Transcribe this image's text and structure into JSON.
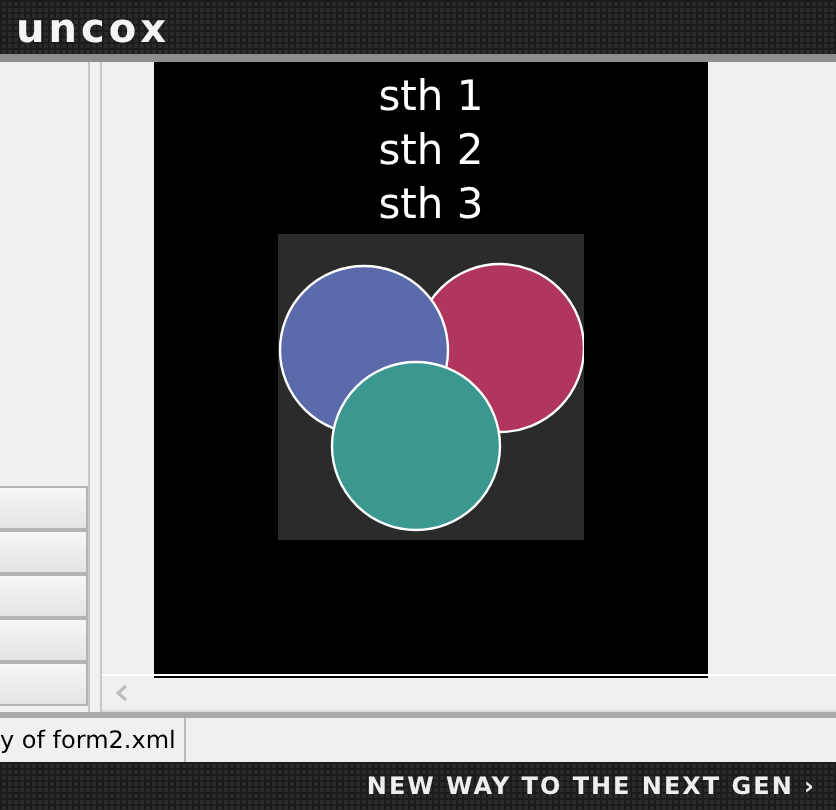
{
  "header": {
    "logo": "uncox"
  },
  "left_panel": {
    "buttons": [
      {
        "disabled": false
      },
      {
        "disabled": false
      },
      {
        "disabled": false
      },
      {
        "disabled": false
      },
      {
        "disabled": false
      }
    ]
  },
  "canvas": {
    "lines": [
      "sth 1",
      "sth 2",
      "sth 3"
    ],
    "circles": [
      {
        "color": "#b0365e"
      },
      {
        "color": "#5a6aaa"
      },
      {
        "color": "#3a9890"
      }
    ]
  },
  "tabs": [
    {
      "label": "y of form2.xml",
      "selected": true
    }
  ],
  "footer": {
    "tagline": "NEW WAY TO THE NEXT GEN ›"
  }
}
